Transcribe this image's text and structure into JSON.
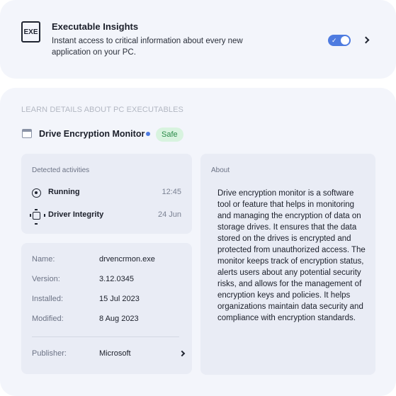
{
  "insights": {
    "icon_text": "EXE",
    "title": "Executable Insights",
    "description": "Instant access to critical information about every new application on your PC.",
    "toggle_on": true
  },
  "main": {
    "section_heading": "LEARN DETAILS ABOUT PC EXECUTABLES",
    "app_name": "Drive Encryption Monitor",
    "status_badge": "Safe",
    "activities": {
      "label": "Detected activities",
      "items": [
        {
          "name": "Running",
          "time": "12:45",
          "icon": "running-icon"
        },
        {
          "name": "Driver Integrity",
          "time": "24 Jun",
          "icon": "chip-icon"
        }
      ]
    },
    "details": {
      "rows": [
        {
          "key": "Name:",
          "value": "drvencrmon.exe"
        },
        {
          "key": "Version:",
          "value": "3.12.0345"
        },
        {
          "key": "Installed:",
          "value": "15 Jul 2023"
        },
        {
          "key": "Modified:",
          "value": "8 Aug 2023"
        }
      ],
      "publisher_key": "Publisher:",
      "publisher_value": "Microsoft"
    },
    "about": {
      "label": "About",
      "text": "Drive encryption monitor is a software tool or feature that helps in monitoring and managing the encryption of data on storage drives. It ensures that the data stored on the drives is encrypted and protected from unauthorized access. The monitor keeps track of encryption status, alerts users about any potential security risks, and allows for the management of encryption keys and policies. It helps organizations maintain data security and compliance with encryption standards."
    }
  },
  "colors": {
    "accent": "#4e7be0",
    "badge_bg": "#d8f3df",
    "badge_text": "#2a8a48",
    "card_bg": "#f3f5fb",
    "panel_bg": "#e9ecf5"
  }
}
